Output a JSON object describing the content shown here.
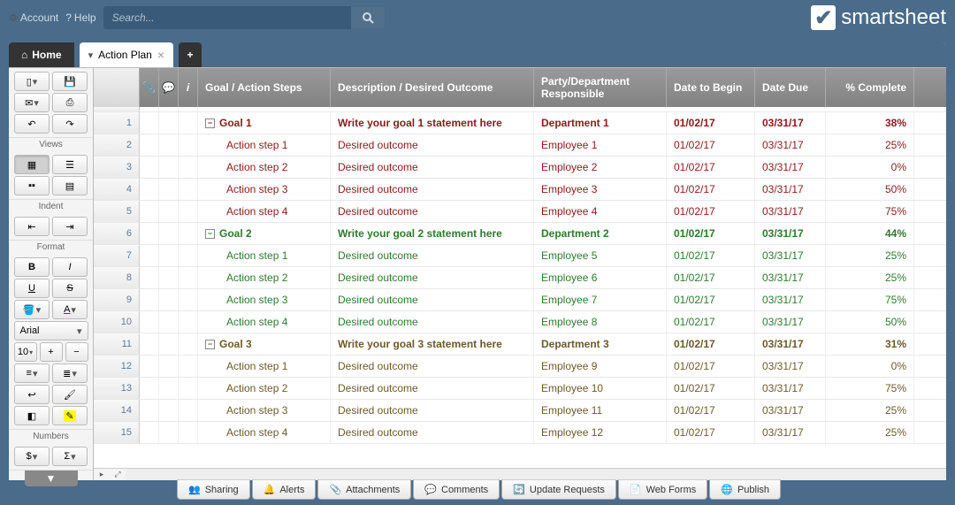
{
  "topbar": {
    "account": "Account",
    "help": "Help",
    "search_placeholder": "Search...",
    "brand": "smartsheet"
  },
  "tabs": {
    "home": "Home",
    "sheet": "Action Plan"
  },
  "sidebar": {
    "views": "Views",
    "indent": "Indent",
    "format": "Format",
    "font": "Arial",
    "fontsize": "10",
    "numbers": "Numbers"
  },
  "columns": {
    "goal": "Goal / Action Steps",
    "desc": "Description / Desired Outcome",
    "party": "Party/Department Responsible",
    "begin": "Date to Begin",
    "due": "Date Due",
    "pct": "% Complete"
  },
  "rows": [
    {
      "n": 1,
      "parent": true,
      "color": "maroon",
      "goal": "Goal 1",
      "desc": "Write your goal 1 statement here",
      "party": "Department 1",
      "begin": "01/02/17",
      "due": "03/31/17",
      "pct": "38%"
    },
    {
      "n": 2,
      "parent": false,
      "color": "maroon",
      "goal": "Action step 1",
      "desc": "Desired outcome",
      "party": "Employee 1",
      "begin": "01/02/17",
      "due": "03/31/17",
      "pct": "25%"
    },
    {
      "n": 3,
      "parent": false,
      "color": "maroon",
      "goal": "Action step 2",
      "desc": "Desired outcome",
      "party": "Employee 2",
      "begin": "01/02/17",
      "due": "03/31/17",
      "pct": "0%"
    },
    {
      "n": 4,
      "parent": false,
      "color": "maroon",
      "goal": "Action step 3",
      "desc": "Desired outcome",
      "party": "Employee 3",
      "begin": "01/02/17",
      "due": "03/31/17",
      "pct": "50%"
    },
    {
      "n": 5,
      "parent": false,
      "color": "maroon",
      "goal": "Action step 4",
      "desc": "Desired outcome",
      "party": "Employee 4",
      "begin": "01/02/17",
      "due": "03/31/17",
      "pct": "75%"
    },
    {
      "n": 6,
      "parent": true,
      "color": "green",
      "goal": "Goal 2",
      "desc": "Write your goal 2 statement here",
      "party": "Department 2",
      "begin": "01/02/17",
      "due": "03/31/17",
      "pct": "44%"
    },
    {
      "n": 7,
      "parent": false,
      "color": "green",
      "goal": "Action step 1",
      "desc": "Desired outcome",
      "party": "Employee 5",
      "begin": "01/02/17",
      "due": "03/31/17",
      "pct": "25%"
    },
    {
      "n": 8,
      "parent": false,
      "color": "green",
      "goal": "Action step 2",
      "desc": "Desired outcome",
      "party": "Employee 6",
      "begin": "01/02/17",
      "due": "03/31/17",
      "pct": "25%"
    },
    {
      "n": 9,
      "parent": false,
      "color": "green",
      "goal": "Action step 3",
      "desc": "Desired outcome",
      "party": "Employee 7",
      "begin": "01/02/17",
      "due": "03/31/17",
      "pct": "75%"
    },
    {
      "n": 10,
      "parent": false,
      "color": "green",
      "goal": "Action step 4",
      "desc": "Desired outcome",
      "party": "Employee 8",
      "begin": "01/02/17",
      "due": "03/31/17",
      "pct": "50%"
    },
    {
      "n": 11,
      "parent": true,
      "color": "olive",
      "goal": "Goal 3",
      "desc": "Write your goal 3 statement here",
      "party": "Department 3",
      "begin": "01/02/17",
      "due": "03/31/17",
      "pct": "31%"
    },
    {
      "n": 12,
      "parent": false,
      "color": "olive",
      "goal": "Action step 1",
      "desc": "Desired outcome",
      "party": "Employee 9",
      "begin": "01/02/17",
      "due": "03/31/17",
      "pct": "0%"
    },
    {
      "n": 13,
      "parent": false,
      "color": "olive",
      "goal": "Action step 2",
      "desc": "Desired outcome",
      "party": "Employee 10",
      "begin": "01/02/17",
      "due": "03/31/17",
      "pct": "75%"
    },
    {
      "n": 14,
      "parent": false,
      "color": "olive",
      "goal": "Action step 3",
      "desc": "Desired outcome",
      "party": "Employee 11",
      "begin": "01/02/17",
      "due": "03/31/17",
      "pct": "25%"
    },
    {
      "n": 15,
      "parent": false,
      "color": "olive",
      "goal": "Action step 4",
      "desc": "Desired outcome",
      "party": "Employee 12",
      "begin": "01/02/17",
      "due": "03/31/17",
      "pct": "25%"
    }
  ],
  "bottombar": {
    "sharing": "Sharing",
    "alerts": "Alerts",
    "attachments": "Attachments",
    "comments": "Comments",
    "update": "Update Requests",
    "webforms": "Web Forms",
    "publish": "Publish"
  }
}
